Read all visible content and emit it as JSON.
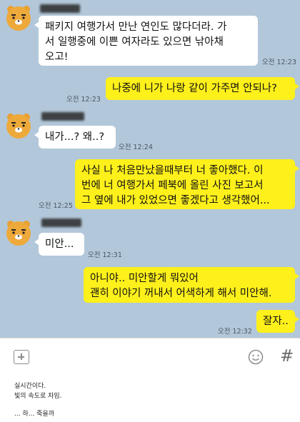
{
  "chat": {
    "messages": [
      {
        "text": "패키지 여행가서 만난 연인도 많다더라. 가\n서 일행중에 이쁜 여자라도 있으면 낚아채\n오고!",
        "time": "오전 12:23"
      },
      {
        "text": "나중에 니가 나랑 같이 가주면 안되나?",
        "time": "오전 12:23"
      },
      {
        "text": "내가...? 왜..?",
        "time": "오전 12:24"
      },
      {
        "text": "사실 나 처음만났을때부터 너 좋아했다. 이\n번에 너 여행가서 페북에 올린 사진 보고서\n그 옆에 내가 있었으면 좋겠다고 생각했어...",
        "time": "오전 12:25"
      },
      {
        "text": "미안...",
        "time": "오전 12:31"
      },
      {
        "text": "아니야.. 미안할게 뭐있어\n괜히 이야기 꺼내서 어색하게 해서 미안해.",
        "time": ""
      },
      {
        "text": "잘자..",
        "time": "오전 12:32"
      }
    ]
  },
  "icons": {
    "attach": "plus-box-icon",
    "emoji": "smiley-icon",
    "hashtag": "hash-icon",
    "hash_glyph": "#"
  },
  "caption": {
    "line1": "실시간이다.",
    "line2": "빛의 속도로 차임.",
    "line3": "... 하... 죽을까"
  }
}
